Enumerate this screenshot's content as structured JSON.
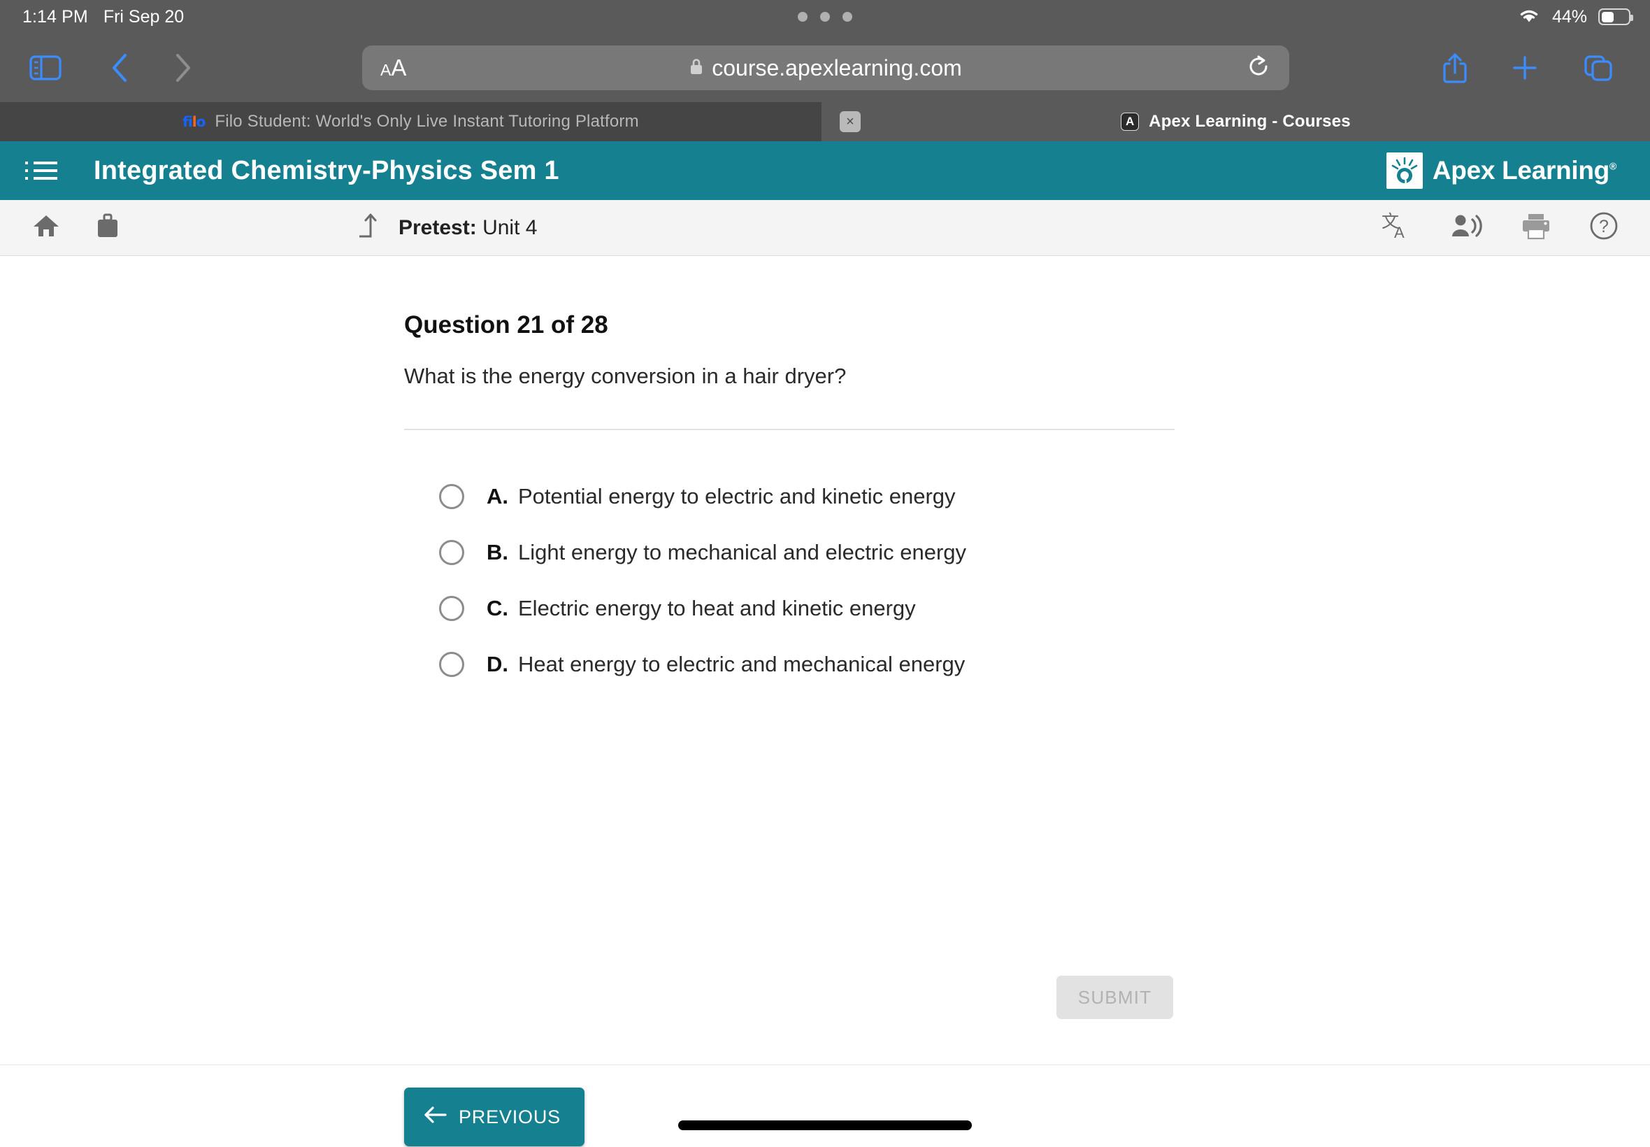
{
  "status_bar": {
    "time": "1:14 PM",
    "date": "Fri Sep 20",
    "battery_percent": "44%",
    "wifi_icon": "wifi-icon",
    "battery_icon": "battery-icon",
    "multitask_handle": "multitasking-dots"
  },
  "browser": {
    "sidebar_icon": "sidebar-toggle-icon",
    "back_icon": "back-chevron-icon",
    "forward_icon": "forward-chevron-icon",
    "text_size_label_small": "A",
    "text_size_label_large": "A",
    "lock_icon": "lock-icon",
    "url": "course.apexlearning.com",
    "reload_icon": "reload-icon",
    "share_icon": "share-icon",
    "new_tab_icon": "plus-icon",
    "tabs_icon": "tab-overview-icon",
    "tabs": [
      {
        "title": "Filo Student: World's Only Live Instant Tutoring Platform",
        "favicon": "filo-favicon",
        "active": false
      },
      {
        "title": "Apex Learning - Courses",
        "favicon": "apex-favicon",
        "favicon_letter": "A",
        "active": true
      }
    ],
    "close_tab_label": "×"
  },
  "apex_header": {
    "menu_icon": "hamburger-menu-icon",
    "course_title": "Integrated Chemistry-Physics Sem 1",
    "logo_text": "Apex Learning",
    "logo_trademark": "®",
    "brand_color": "#15808f"
  },
  "sub_toolbar": {
    "home_icon": "home-icon",
    "briefcase_icon": "briefcase-icon",
    "activity_icon": "upload-arrow-icon",
    "activity_type": "Pretest:",
    "activity_name": "Unit 4",
    "translate_icon": "translate-icon",
    "read_aloud_icon": "text-to-speech-icon",
    "print_icon": "print-icon",
    "help_icon": "help-icon"
  },
  "question": {
    "heading": "Question 21 of 28",
    "number": 21,
    "total": 28,
    "prompt": "What is the energy conversion in a hair dryer?",
    "options": [
      {
        "letter": "A.",
        "text": "Potential energy to electric and kinetic energy",
        "selected": false
      },
      {
        "letter": "B.",
        "text": "Light energy to mechanical and electric energy",
        "selected": false
      },
      {
        "letter": "C.",
        "text": "Electric energy to heat and kinetic energy",
        "selected": false
      },
      {
        "letter": "D.",
        "text": "Heat energy to electric and mechanical energy",
        "selected": false
      }
    ],
    "submit_label": "SUBMIT",
    "submit_enabled": false
  },
  "footer": {
    "previous_label": "PREVIOUS",
    "previous_arrow_icon": "left-arrow-icon",
    "home_indicator": "home-indicator"
  }
}
